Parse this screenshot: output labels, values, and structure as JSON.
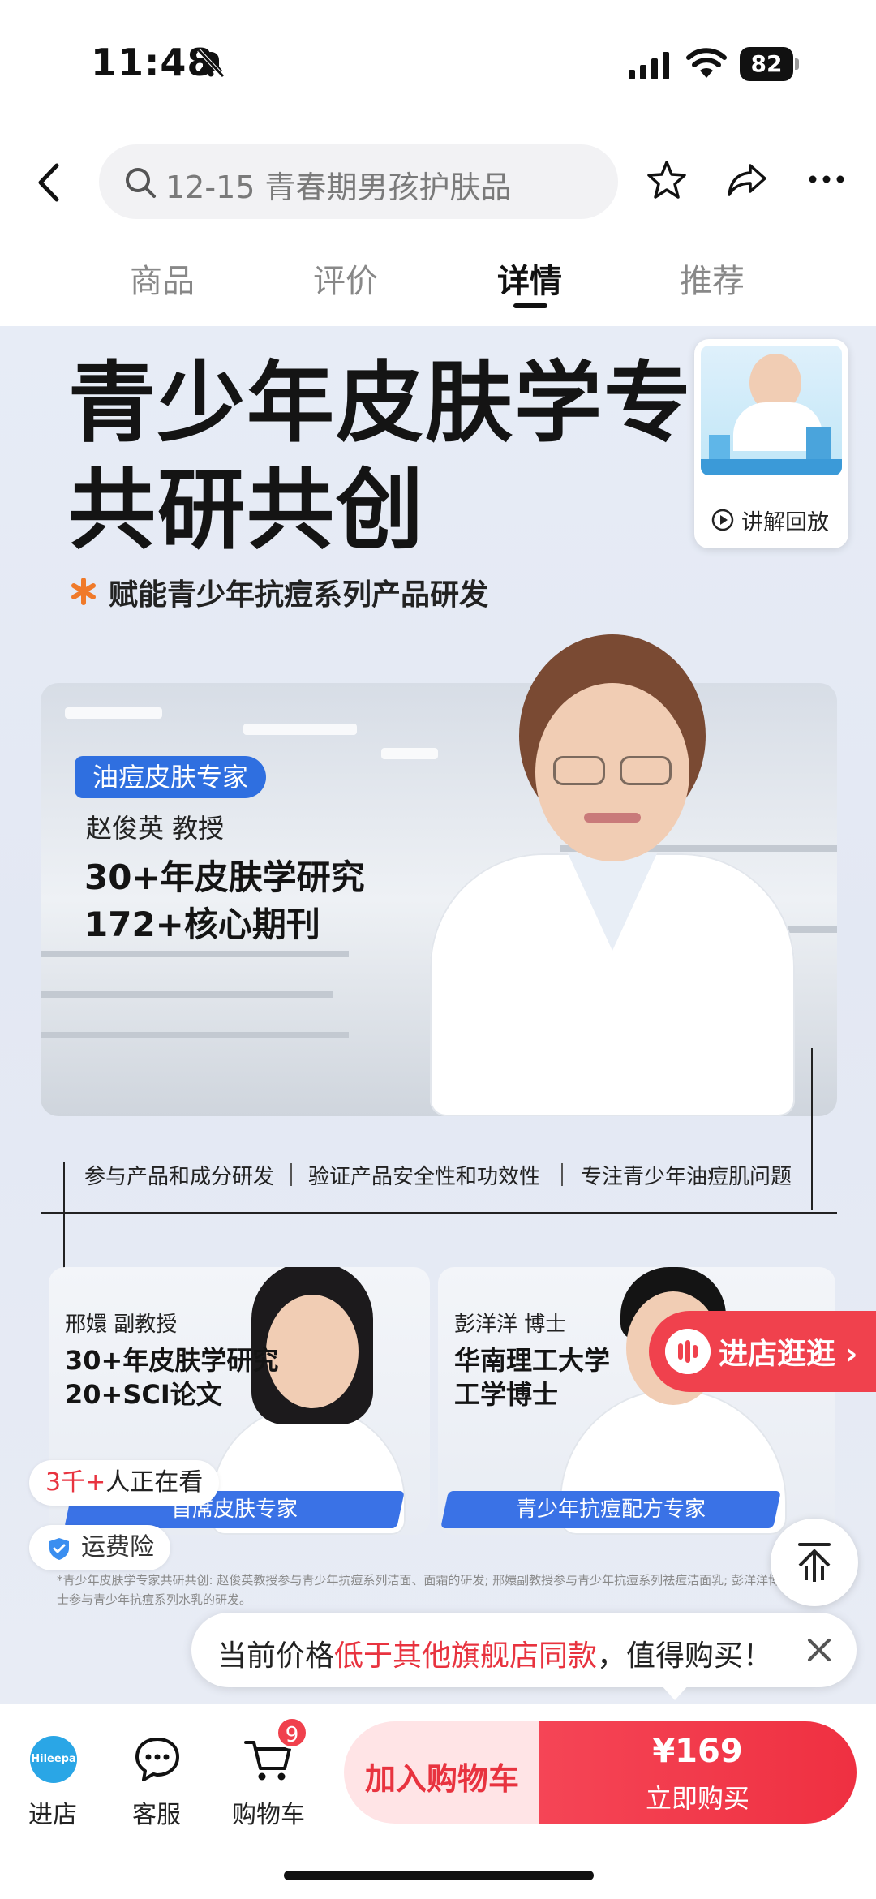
{
  "status_bar": {
    "time": "11:48",
    "battery": "82"
  },
  "search": {
    "placeholder": "12-15 青春期男孩护肤品"
  },
  "tabs": [
    {
      "label": "商品"
    },
    {
      "label": "评价"
    },
    {
      "label": "详情"
    },
    {
      "label": "推荐"
    }
  ],
  "hero": {
    "title_line1": "青少年皮肤学专",
    "title_line2": "共研共创",
    "subtitle": "赋能青少年抗痘系列产品研发",
    "main_expert": {
      "tag": "油痘皮肤专家",
      "name": "赵俊英 教授",
      "line1": "30+年皮肤学研究",
      "line2": "172+核心期刊"
    },
    "features": [
      "参与产品和成分研发",
      "验证产品安全性和功效性",
      "专注青少年油痘肌问题"
    ],
    "expert_left": {
      "name": "邢嬛 副教授",
      "line1": "30+年皮肤学研究",
      "line2": "20+SCI论文",
      "ribbon": "首席皮肤专家"
    },
    "expert_right": {
      "name": "彭洋洋 博士",
      "line1": "华南理工大学",
      "line2": "工学博士",
      "ribbon": "青少年抗痘配方专家"
    },
    "footnote": "*青少年皮肤学专家共研共创: 赵俊英教授参与青少年抗痘系列洁面、面霜的研发; 邢嬛副教授参与青少年抗痘系列祛痘洁面乳; 彭洋洋博士参与青少年抗痘系列水乳的研发。"
  },
  "video": {
    "label": "讲解回放"
  },
  "float": {
    "enter_shop": "进店逛逛",
    "viewers_count": "3千+",
    "viewers_suffix": "人正在看",
    "shipping": "运费险"
  },
  "price_tip": {
    "prefix": "当前价格",
    "highlight": "低于其他旗舰店同款",
    "suffix": "，值得购买！"
  },
  "bottom_bar": {
    "shop_logo": "Hileepa",
    "shop_label": "进店",
    "service_label": "客服",
    "cart_label": "购物车",
    "cart_count": "9",
    "add_cart": "加入购物车",
    "price": "¥169",
    "buy_now": "立即购买"
  },
  "colors": {
    "accent": "#f0414d",
    "brand_blue": "#2f6fe0"
  }
}
